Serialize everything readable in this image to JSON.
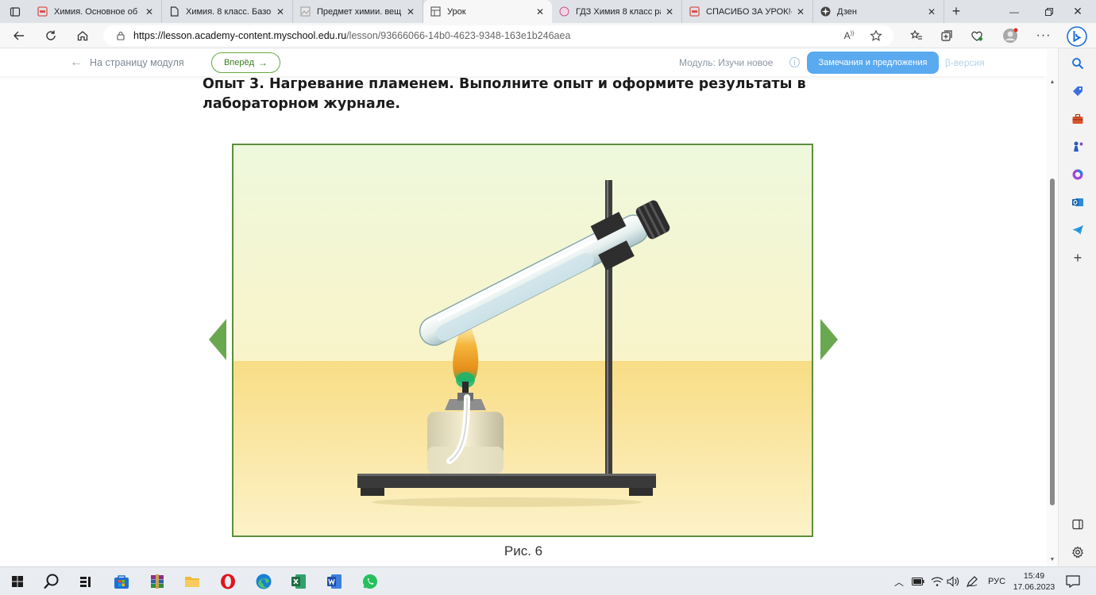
{
  "tabs": [
    {
      "title": "Химия. Основное об",
      "favicon": "pdf-icon",
      "active": false
    },
    {
      "title": "Химия. 8 класс. Базов",
      "favicon": "document-icon",
      "active": false
    },
    {
      "title": "Предмет химии. вещ",
      "favicon": "image-icon",
      "active": false
    },
    {
      "title": "Урок",
      "favicon": "lesson-icon",
      "active": true
    },
    {
      "title": "ГДЗ Химия 8 класс ра",
      "favicon": "gdz-icon",
      "active": false
    },
    {
      "title": "СПАСИБО ЗА УРОК!-",
      "favicon": "pdf-icon",
      "active": false
    },
    {
      "title": "Дзен",
      "favicon": "zen-icon",
      "active": false
    }
  ],
  "address": {
    "host": "https://lesson.academy-content.myschool.edu.ru",
    "path": "/lesson/93666066-14b0-4623-9348-163e1b246aea"
  },
  "header": {
    "back_label": "На страницу модуля",
    "next_label": "Вперёд",
    "module_label": "Модуль: Изучи новое",
    "feedback_label": "Замечания и предложения",
    "beta_label": "β-версия"
  },
  "task": {
    "title": "Опыт 3. Нагревание пламенем. Выполните опыт и оформите результаты в лабораторном журнале."
  },
  "figure": {
    "caption": "Рис. 6"
  },
  "taskbar": {
    "language": "РУС",
    "time": "15:49",
    "date": "17.06.2023"
  },
  "colors": {
    "accent_blue": "#5aaaf0",
    "accent_green": "#66aa44",
    "frame_green": "#5d8f3e"
  }
}
